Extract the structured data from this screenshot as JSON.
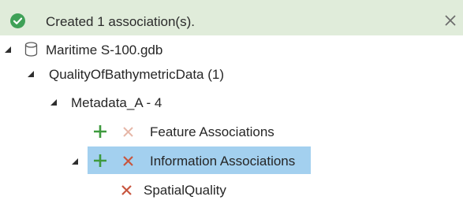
{
  "banner": {
    "message": "Created 1 association(s).",
    "status_icon": "check-circle-icon",
    "close_icon": "close-icon",
    "status_color": "#3fa157",
    "background_color": "#e0ecda"
  },
  "tree": {
    "database": {
      "label": "Maritime S-100.gdb",
      "icon": "database-icon",
      "expanded": true
    },
    "feature_class": {
      "label": "QualityOfBathymetricData (1)",
      "expanded": true
    },
    "feature": {
      "label": "Metadata_A - 4",
      "expanded": true
    },
    "feature_associations": {
      "label": "Feature Associations",
      "add_icon": "plus-icon",
      "remove_icon": "x-icon",
      "remove_enabled": false
    },
    "information_associations": {
      "label": "Information Associations",
      "add_icon": "plus-icon",
      "remove_icon": "x-icon",
      "selected": true,
      "expanded": true
    },
    "spatial_quality": {
      "label": "SpatialQuality",
      "remove_icon": "x-icon"
    }
  },
  "colors": {
    "add": "#3e9a3e",
    "remove": "#c8563f",
    "remove_disabled": "#e6b7a8",
    "selection": "#a3d0ef"
  }
}
